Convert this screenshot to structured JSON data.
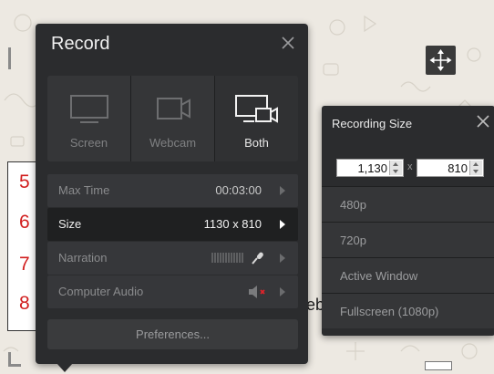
{
  "annotations": {
    "numbers": [
      "5",
      "6",
      "7",
      "8"
    ]
  },
  "record_panel": {
    "title": "Record",
    "modes": [
      {
        "label": "Screen",
        "icon": "monitor-icon",
        "active": false
      },
      {
        "label": "Webcam",
        "icon": "webcam-icon",
        "active": false
      },
      {
        "label": "Both",
        "icon": "screen-and-webcam-icon",
        "active": true
      }
    ],
    "settings": [
      {
        "label": "Max Time",
        "value": "00:03:00"
      },
      {
        "label": "Size",
        "value": "1130 x 810"
      },
      {
        "label": "Narration",
        "value": ""
      },
      {
        "label": "Computer Audio",
        "value": ""
      }
    ],
    "preferences_label": "Preferences..."
  },
  "size_panel": {
    "title": "Recording Size",
    "width_value": "1,130",
    "height_value": "810",
    "separator": "x",
    "options": [
      "480p",
      "720p",
      "Active Window",
      "Fullscreen  (1080p)"
    ]
  },
  "background": {
    "partial_text": "eb"
  },
  "colors": {
    "panel_bg": "#2b2c2e",
    "annotation_red": "#d11e1e"
  }
}
